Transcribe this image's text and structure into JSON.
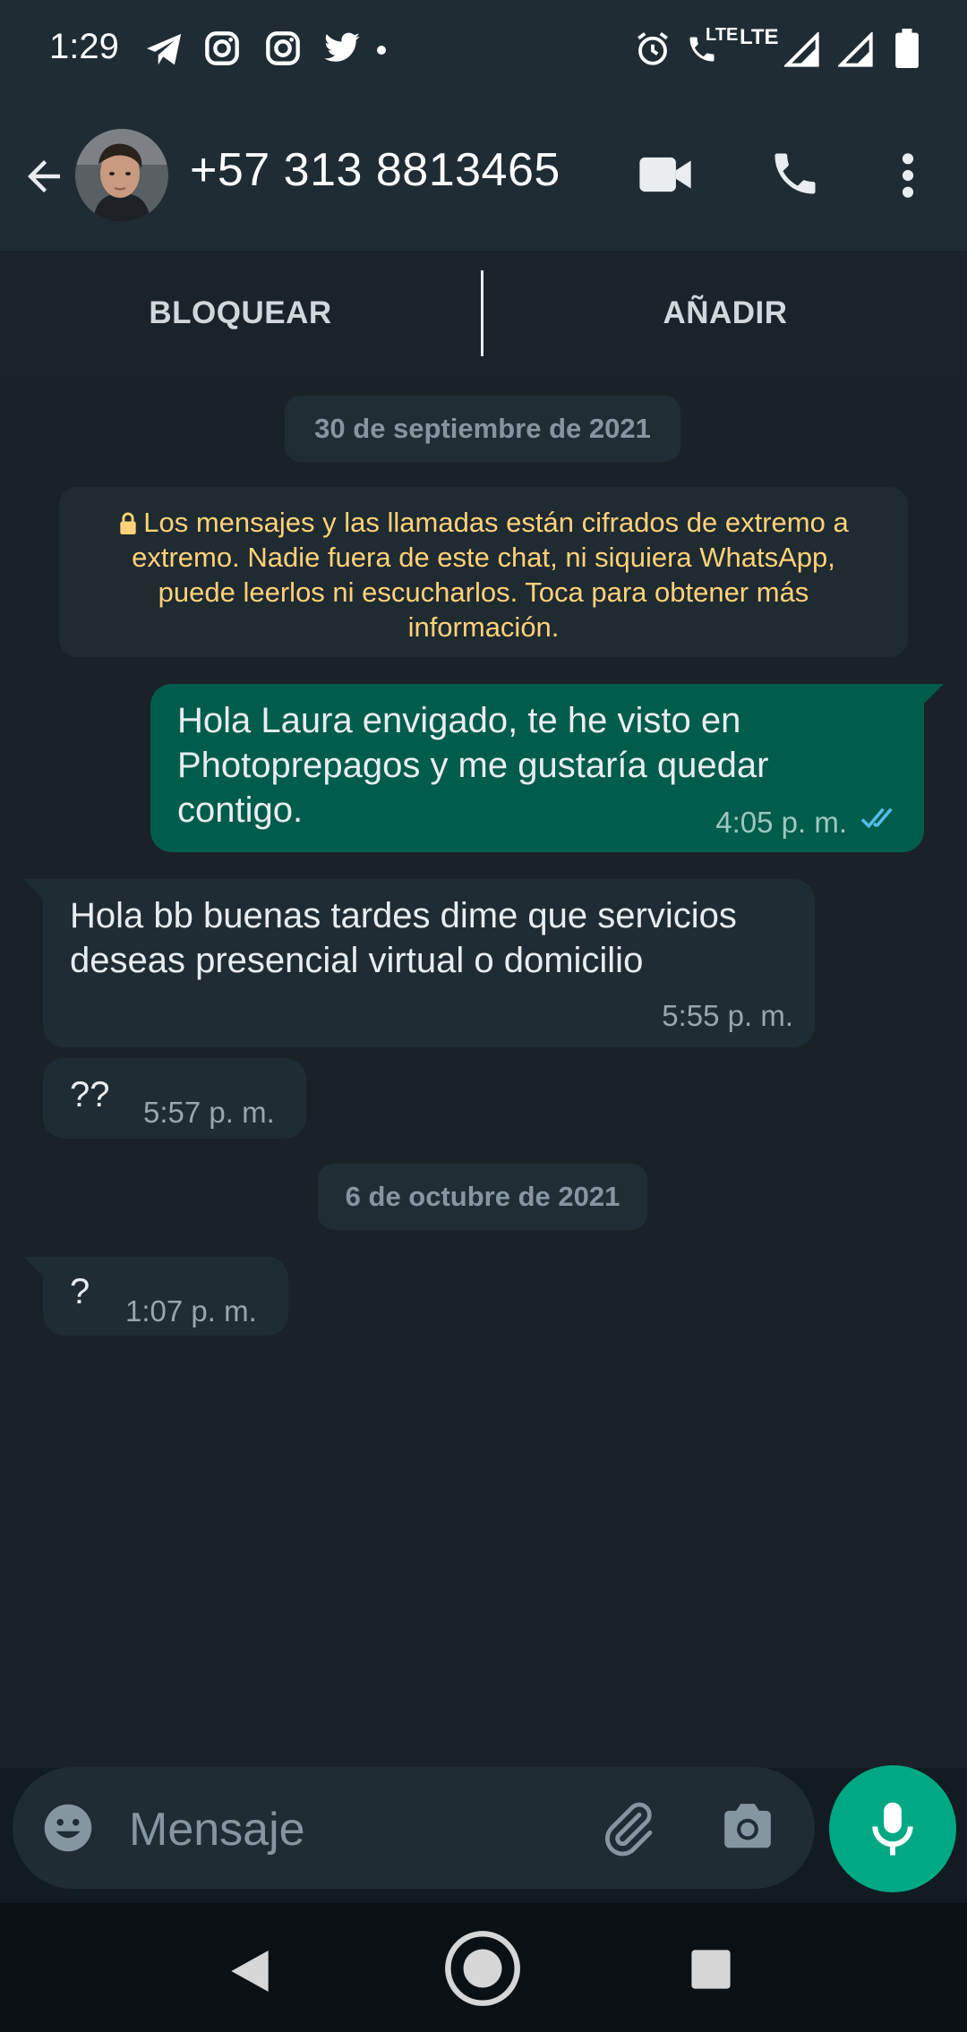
{
  "status_bar": {
    "time": "1:29",
    "icons": [
      "telegram-icon",
      "instagram-icon",
      "instagram-icon",
      "twitter-icon",
      "dot-icon",
      "alarm-icon",
      "volte-call-icon",
      "signal-icon",
      "signal-icon",
      "battery-icon"
    ],
    "network_label": "LTE",
    "call_label": "LTE"
  },
  "header": {
    "contact_name": "+57 313 8813465",
    "icons": [
      "back-arrow-icon",
      "video-call-icon",
      "phone-icon",
      "more-vert-icon"
    ]
  },
  "action_bar": {
    "block_label": "BLOQUEAR",
    "add_label": "AÑADIR"
  },
  "chat": {
    "date_1": "30 de septiembre de 2021",
    "encryption_notice": "Los mensajes y las llamadas están cifrados de extremo a extremo. Nadie fuera de este chat, ni siquiera WhatsApp, puede leerlos ni escucharlos. Toca para obtener más información.",
    "messages": [
      {
        "direction": "out",
        "text": "Hola Laura envigado, te he visto en Photoprepagos y me gustaría quedar contigo.",
        "time": "4:05 p. m.",
        "status": "read"
      },
      {
        "direction": "in",
        "text": "Hola bb buenas tardes dime que servicios deseas presencial virtual o domicilio",
        "time": "5:55 p. m."
      },
      {
        "direction": "in",
        "text": "??",
        "time": "5:57 p. m."
      },
      {
        "direction": "in",
        "text": "?",
        "time": "1:07 p. m."
      }
    ],
    "date_2": "6 de octubre de 2021"
  },
  "composer": {
    "placeholder": "Mensaje",
    "icons": [
      "emoji-icon",
      "attach-icon",
      "camera-icon",
      "mic-icon"
    ]
  },
  "colors": {
    "header_bg": "#1f2c34",
    "chat_bg": "#1a2228",
    "outgoing_bubble": "#005c4b",
    "incoming_bubble": "#202c33",
    "accent": "#00a884",
    "read_ticks": "#53bdeb",
    "encryption_text": "#ffd279"
  }
}
